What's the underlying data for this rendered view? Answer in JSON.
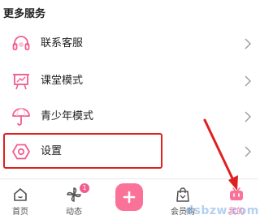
{
  "section": {
    "title": "更多服务"
  },
  "menu": {
    "items": [
      {
        "label": "联系客服",
        "icon": "headset-icon"
      },
      {
        "label": "课堂模式",
        "icon": "classroom-icon"
      },
      {
        "label": "青少年模式",
        "icon": "umbrella-icon"
      },
      {
        "label": "设置",
        "icon": "gear-icon"
      }
    ]
  },
  "tabbar": {
    "items": [
      {
        "label": "首页",
        "icon": "home-icon"
      },
      {
        "label": "动态",
        "icon": "pinwheel-icon",
        "badge": "1"
      },
      {
        "label": "会员购",
        "icon": "shopping-bag-icon"
      },
      {
        "label": "我的",
        "icon": "tv-icon",
        "active": true
      }
    ],
    "publish_icon": "plus-icon"
  },
  "annotation": {
    "highlight_color": "#e02020",
    "arrow_color": "#e02020"
  },
  "colors": {
    "accent": "#fb7299",
    "icon": "#f25d8e",
    "text": "#212121",
    "muted": "#505050"
  },
  "watermark": "dsbzw.com"
}
